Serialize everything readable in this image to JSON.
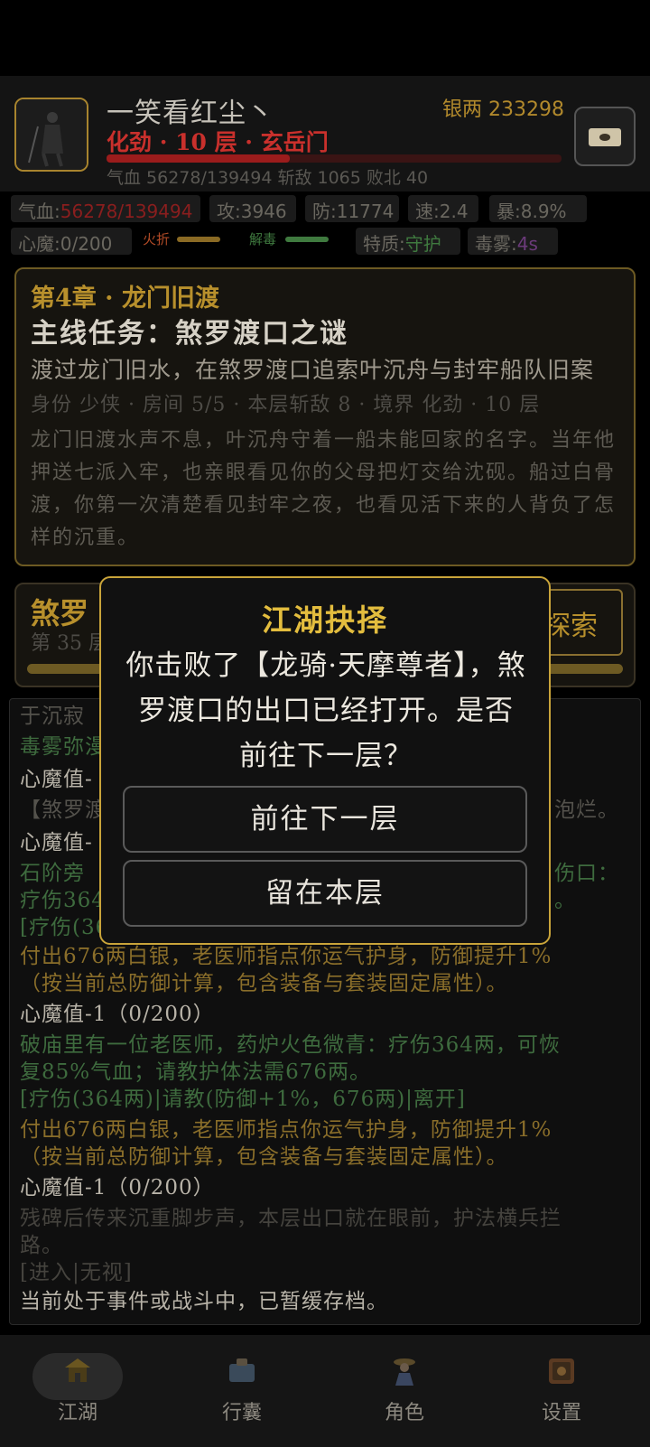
{
  "header": {
    "player_name": "一笑看红尘丶",
    "realm": "化劲 · 10 层 · 玄岳门",
    "silver_label": "银两 233298",
    "hp_fraction": 0.403,
    "stats_line": "气血 56278/139494   斩敌 1065   败北 40"
  },
  "stats": {
    "hp_label": "气血:",
    "hp_value": "56278/139494",
    "attack": "攻:3946",
    "defense": "防:11774",
    "speed": "速:2.4",
    "crit": "暴:8.9%",
    "demon": "心魔:0/200",
    "fire_break": "火折",
    "detox": "解毒",
    "trait_label": "特质:",
    "trait_value": "守护",
    "poison_label": "毒雾:",
    "poison_value": "4s"
  },
  "quest": {
    "chapter": "第4章 · 龙门旧渡",
    "main": "主线任务：煞罗渡口之谜",
    "goal": "渡过龙门旧水，在煞罗渡口追索叶沉舟与封牢船队旧案",
    "info": "身份 少侠 · 房间 5/5 · 本层斩敌 8 · 境界 化劲 · 10 层",
    "story": "龙门旧渡水声不息，叶沉舟守着一船未能回家的名字。当年他押送七派入牢，也亲眼看见你的父母把灯交给沈砚。船过白骨渡，你第一次清楚看见封牢之夜，也看见活下来的人背负了怎样的沉重。"
  },
  "floor": {
    "name": "煞罗",
    "sub": "第 35 层",
    "explore_label": "探索",
    "progress": 1.0
  },
  "log": {
    "l1": "于沉寂",
    "l2": "毒雾弥漫",
    "l3": "心魔值-",
    "l4": "【煞罗渡",
    "l4b": "泡烂。",
    "l5": "心魔值-",
    "l6": "石阶旁",
    "l6b": "伤口：",
    "l7": "疗伤364",
    "l7b": "。",
    "l8": "[疗伤(36",
    "l9": "付出676两白银，老医师指点你运气护身，防御提升1%",
    "l10": "（按当前总防御计算，包含装备与套装固定属性）。",
    "l11": "心魔值-1（0/200）",
    "l12": "破庙里有一位老医师，药炉火色微青：疗伤364两，可恢",
    "l13": "复85%气血；请教护体法需676两。",
    "l14": "[疗伤(364两)|请教(防御+1%，676两)|离开]",
    "l15": "付出676两白银，老医师指点你运气护身，防御提升1%",
    "l16": "（按当前总防御计算，包含装备与套装固定属性）。",
    "l17": "心魔值-1（0/200）",
    "l18": "残碑后传来沉重脚步声，本层出口就在眼前，护法横兵拦",
    "l19": "路。",
    "l20": "[进入|无视]",
    "l21": "当前处于事件或战斗中，已暂缓存档。"
  },
  "dialog": {
    "title": "江湖抉择",
    "message": "你击败了【龙骑·天摩尊者】，煞罗渡口的出口已经打开。是否前往下一层？",
    "confirm": "前往下一层",
    "stay": "留在本层"
  },
  "nav": {
    "jianghu": "江湖",
    "bag": "行囊",
    "role": "角色",
    "settings": "设置"
  }
}
